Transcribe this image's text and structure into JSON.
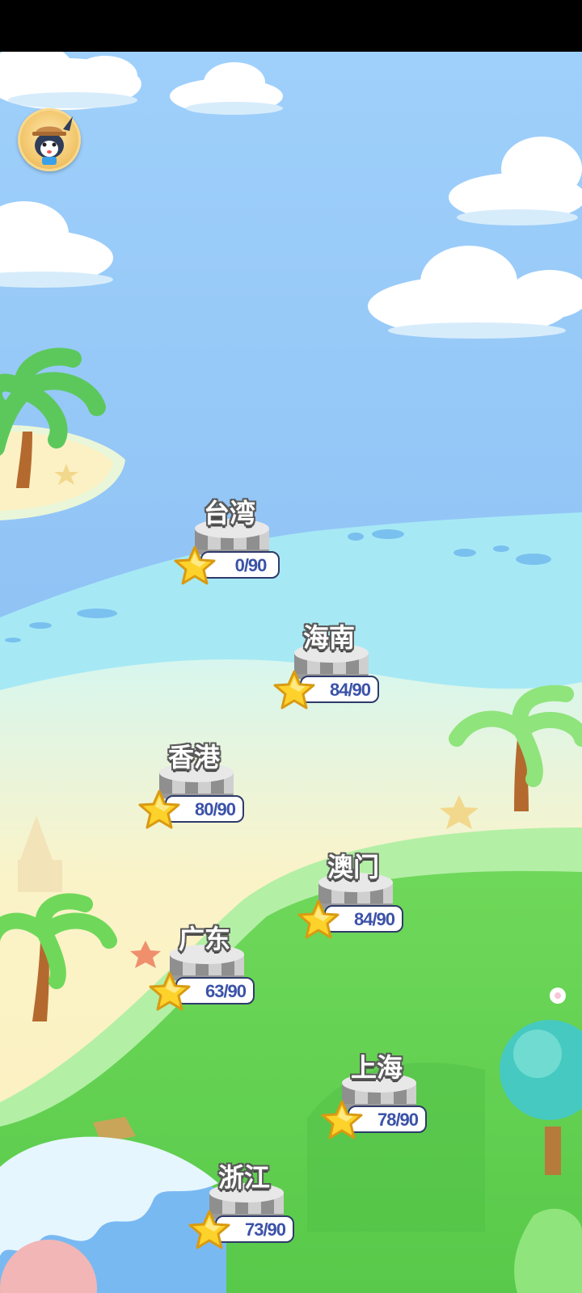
{
  "app": {
    "screen": "level-map"
  },
  "avatar": {
    "icon": "rabbit-avatar-icon"
  },
  "colors": {
    "sky": "#9fcaf7",
    "sea": "#a6e9f5",
    "sand": "#fbf1c4",
    "grass": "#6fd85a",
    "label_outline": "#5a5a5a",
    "score_text": "#3b52a8"
  },
  "nodes": [
    {
      "name": "台湾",
      "score": "0/90"
    },
    {
      "name": "海南",
      "score": "84/90"
    },
    {
      "name": "香港",
      "score": "80/90"
    },
    {
      "name": "澳门",
      "score": "84/90"
    },
    {
      "name": "广东",
      "score": "63/90"
    },
    {
      "name": "上海",
      "score": "78/90"
    },
    {
      "name": "浙江",
      "score": "73/90"
    }
  ]
}
